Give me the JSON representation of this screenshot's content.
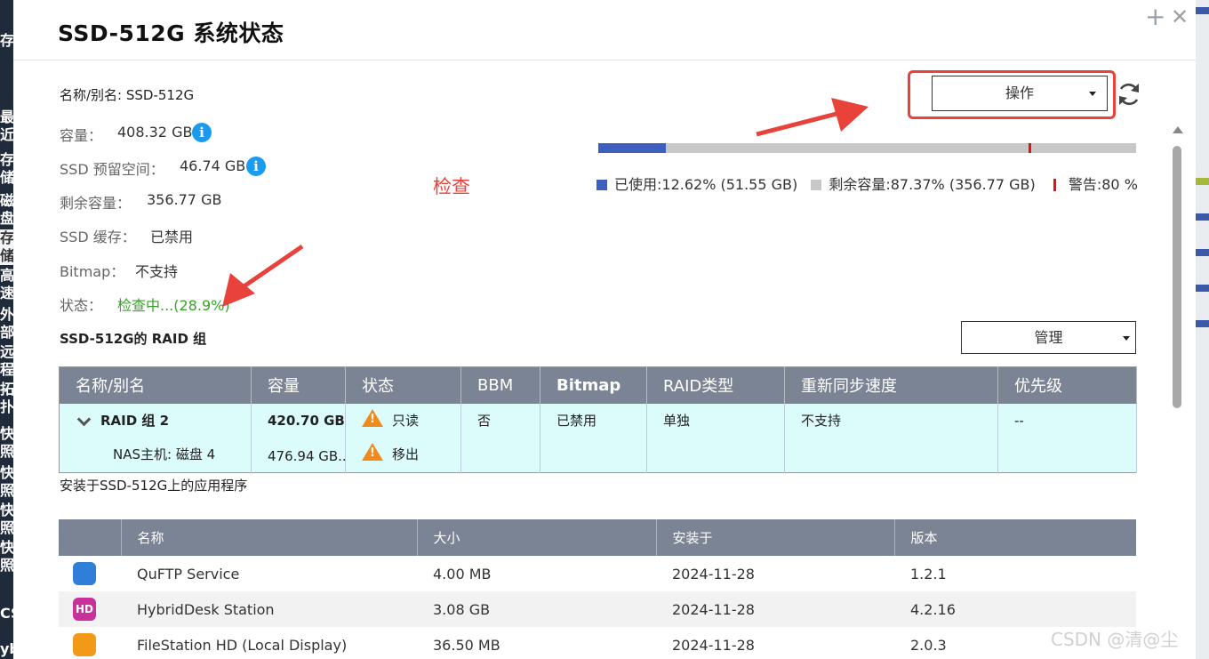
{
  "window": {
    "title": "SSD-512G  系统状态",
    "add_icon": "+",
    "close_icon": "✕"
  },
  "background": {
    "left_chars": [
      "存",
      "最近",
      "存储",
      "磁盘",
      "存储",
      "高速",
      "外部",
      "远程",
      "拓扑",
      "快照",
      "快照",
      "快照",
      "快照",
      "CS",
      "yb"
    ]
  },
  "details": {
    "name_label": "名称/别名: SSD-512G",
    "capacity_label": "容量：",
    "capacity_value": "408.32 GB",
    "ssd_reserve_label": "SSD 预留空间：",
    "ssd_reserve_value": "46.74 GB",
    "free_label": "剩余容量：",
    "free_value": "356.77 GB",
    "ssd_cache_label": "SSD 缓存：",
    "ssd_cache_value": "已禁用",
    "bitmap_label": "Bitmap：",
    "bitmap_value": "不支持",
    "status_label": "状态：",
    "status_value": "检查中...(28.9%)",
    "info_glyph": "i"
  },
  "annotation": {
    "text": "检查"
  },
  "actions": {
    "operate_label": "操作",
    "manage_label": "管理"
  },
  "usage": {
    "used_fraction": 0.1262,
    "warning_fraction": 0.8,
    "used_color": "#3f5fbf",
    "free_color": "#c8c8c8",
    "warning_color": "#e81010",
    "used_legend": "已使用:12.62% (51.55 GB)",
    "free_legend": "剩余容量:87.37% (356.77 GB)",
    "warning_legend": "警告:80 %"
  },
  "raid": {
    "section_title": "SSD-512G的 RAID 组",
    "headers": [
      "名称/别名",
      "容量",
      "状态",
      "BBM",
      "Bitmap",
      "RAID类型",
      "重新同步速度",
      "优先级"
    ],
    "group_name": "RAID 组 2",
    "disk_name": "NAS主机: 磁盘 4",
    "group_capacity": "420.70 GB...",
    "disk_capacity": "476.94 GB...",
    "group_status": "只读",
    "disk_status": "移出",
    "warn_glyph": "!",
    "bbm": "否",
    "bitmap": "已禁用",
    "raid_type": "单独",
    "resync_speed": "不支持",
    "priority": "--"
  },
  "apps": {
    "section_title": "安装于SSD-512G上的应用程序",
    "headers": [
      "",
      "名称",
      "大小",
      "安装于",
      "版本"
    ],
    "rows": [
      {
        "name": "QuFTP Service",
        "size": "4.00 MB",
        "installed": "2024-11-28",
        "version": "1.2.1",
        "icon": "quftp-icon",
        "icon_text": "",
        "icon_color": "#2f7fd8"
      },
      {
        "name": "HybridDesk Station",
        "size": "3.08 GB",
        "installed": "2024-11-28",
        "version": "4.2.16",
        "icon": "hybriddesk-icon",
        "icon_text": "HD",
        "icon_color": "#c8319a"
      },
      {
        "name": "FileStation HD (Local Display)",
        "size": "36.50 MB",
        "installed": "2024-11-28",
        "version": "2.0.3",
        "icon": "folder-icon",
        "icon_text": "",
        "icon_color": "#f29a17"
      }
    ]
  },
  "watermark": "CSDN @清@尘"
}
